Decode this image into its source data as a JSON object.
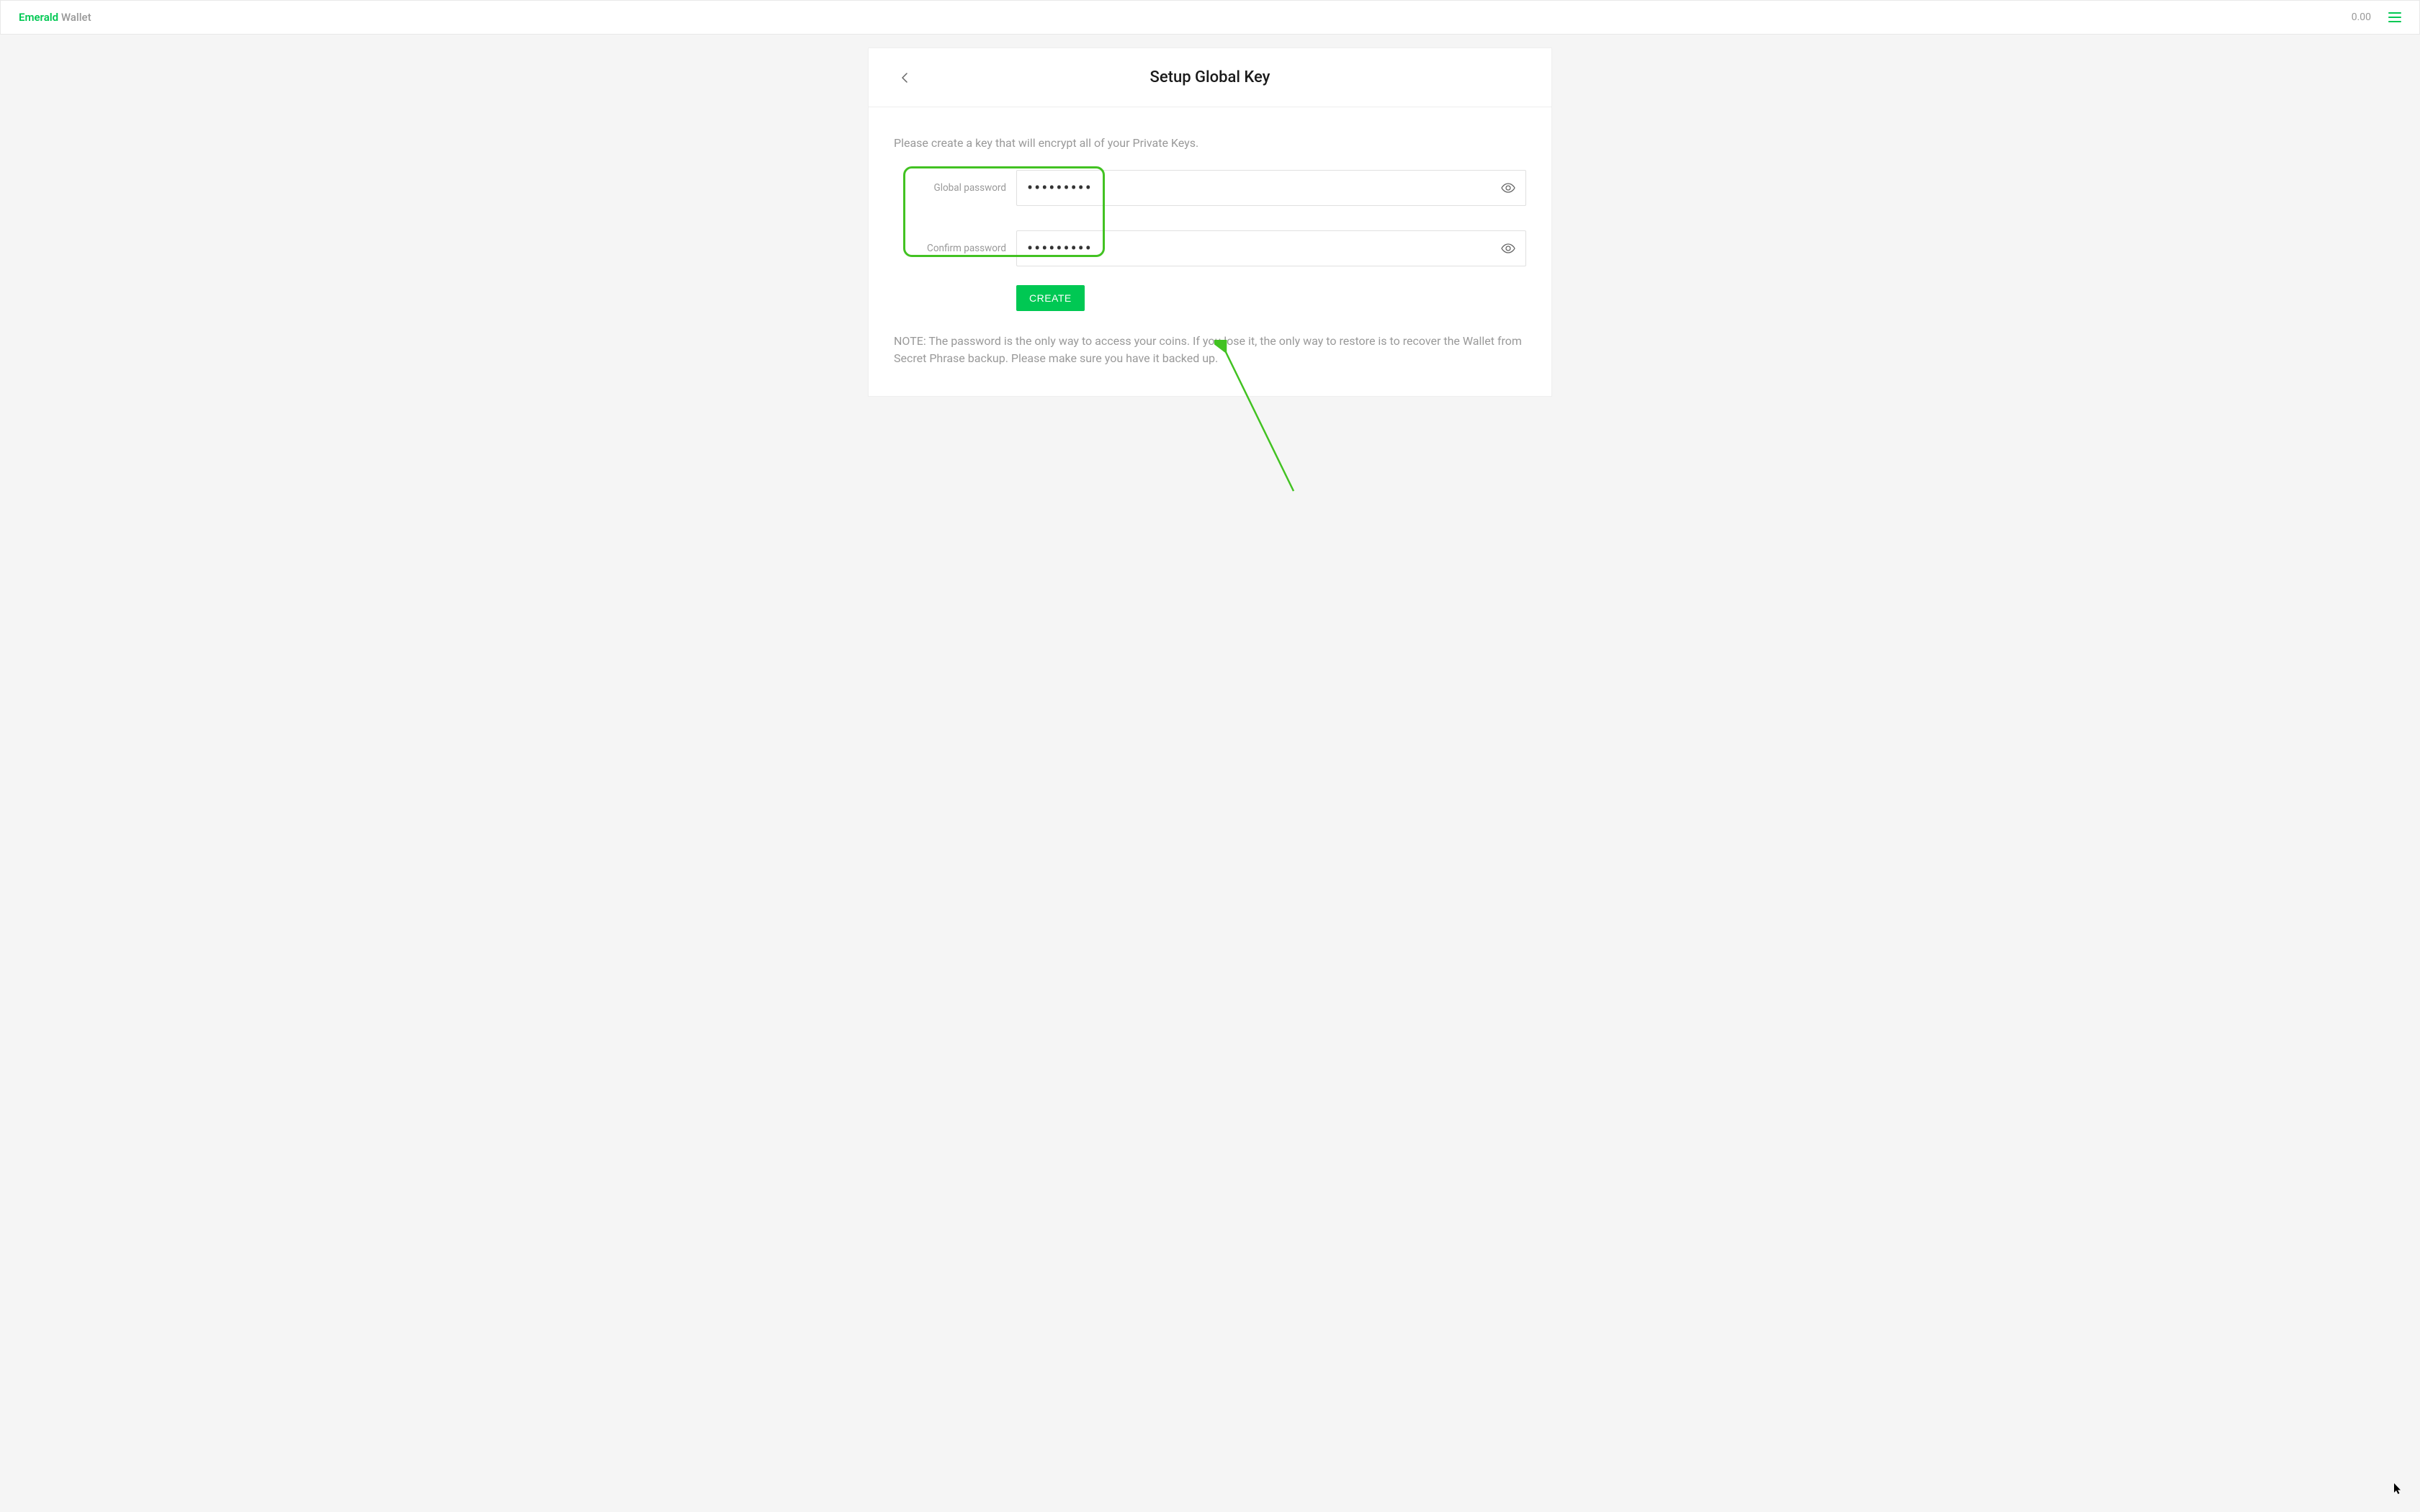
{
  "header": {
    "brand_primary": "Emerald",
    "brand_secondary": " Wallet",
    "balance": "0.00"
  },
  "card": {
    "title": "Setup Global Key",
    "instruction": "Please create a key that will encrypt all of your Private Keys.",
    "fields": {
      "password_label": "Global password",
      "password_value": "•••••••••",
      "confirm_label": "Confirm password",
      "confirm_value": "•••••••••"
    },
    "create_button": "CREATE",
    "note": "NOTE: The password is the only way to access your coins. If you lose it, the only way to restore is to recover the Wallet from Secret Phrase backup. Please make sure you have it backed up."
  }
}
